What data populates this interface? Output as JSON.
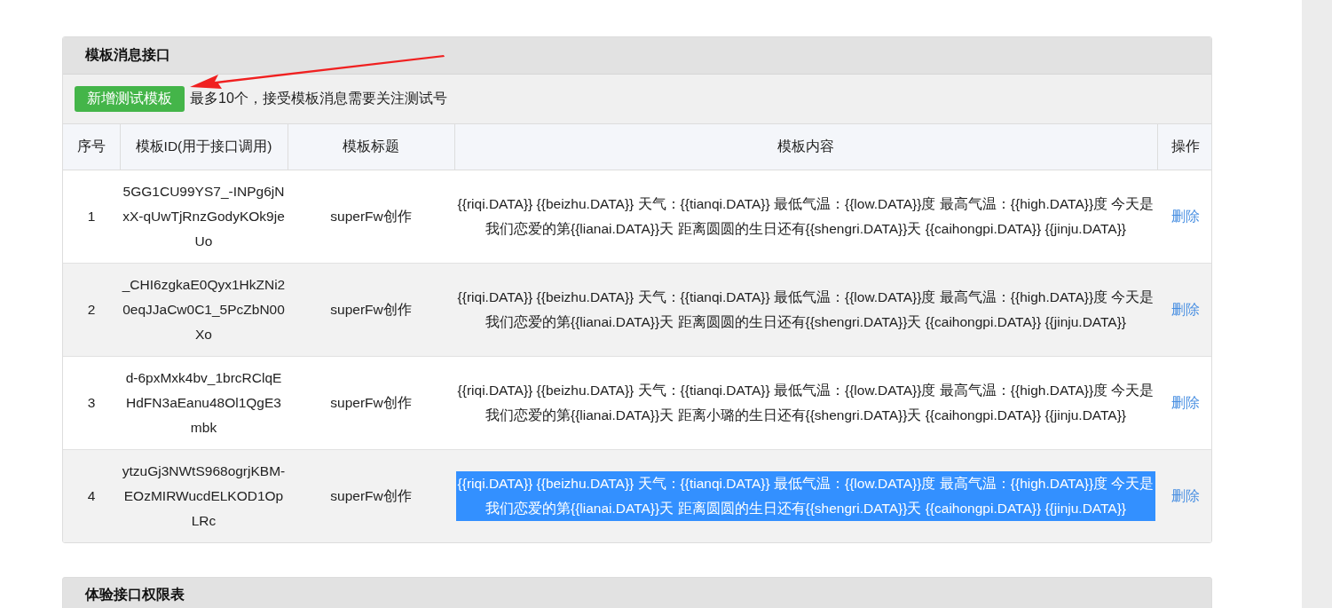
{
  "panel": {
    "title": "模板消息接口",
    "add_button": "新增测试模板",
    "hint": "最多10个，接受模板消息需要关注测试号"
  },
  "table": {
    "columns": [
      "序号",
      "模板ID(用于接口调用)",
      "模板标题",
      "模板内容",
      "操作"
    ],
    "rows": [
      {
        "index": "1",
        "template_id": "5GG1CU99YS7_-INPg6jNxX-qUwTjRnzGodyKOk9jeUo",
        "title": "superFw创作",
        "content": "{{riqi.DATA}} {{beizhu.DATA}} 天气：{{tianqi.DATA}} 最低气温：{{low.DATA}}度 最高气温：{{high.DATA}}度 今天是我们恋爱的第{{lianai.DATA}}天 距离圆圆的生日还有{{shengri.DATA}}天 {{caihongpi.DATA}} {{jinju.DATA}}",
        "action": "删除",
        "text_selected": false
      },
      {
        "index": "2",
        "template_id": "_CHI6zgkaE0Qyx1HkZNi20eqJJaCw0C1_5PcZbN00Xo",
        "title": "superFw创作",
        "content": "{{riqi.DATA}} {{beizhu.DATA}} 天气：{{tianqi.DATA}} 最低气温：{{low.DATA}}度 最高气温：{{high.DATA}}度 今天是我们恋爱的第{{lianai.DATA}}天 距离圆圆的生日还有{{shengri.DATA}}天 {{caihongpi.DATA}} {{jinju.DATA}}",
        "action": "删除",
        "text_selected": false
      },
      {
        "index": "3",
        "template_id": "d-6pxMxk4bv_1brcRClqEHdFN3aEanu48Ol1QgE3mbk",
        "title": "superFw创作",
        "content": "{{riqi.DATA}} {{beizhu.DATA}} 天气：{{tianqi.DATA}} 最低气温：{{low.DATA}}度 最高气温：{{high.DATA}}度 今天是我们恋爱的第{{lianai.DATA}}天 距离小璐的生日还有{{shengri.DATA}}天 {{caihongpi.DATA}} {{jinju.DATA}}",
        "action": "删除",
        "text_selected": false
      },
      {
        "index": "4",
        "template_id": "ytzuGj3NWtS968ogrjKBM-EOzMIRWucdELKOD1OpLRc",
        "title": "superFw创作",
        "content": "{{riqi.DATA}} {{beizhu.DATA}} 天气：{{tianqi.DATA}} 最低气温：{{low.DATA}}度 最高气温：{{high.DATA}}度 今天是我们恋爱的第{{lianai.DATA}}天 距离圆圆的生日还有{{shengri.DATA}}天 {{caihongpi.DATA}} {{jinju.DATA}}",
        "action": "删除",
        "text_selected": true
      }
    ]
  },
  "next_panel": {
    "title": "体验接口权限表"
  }
}
